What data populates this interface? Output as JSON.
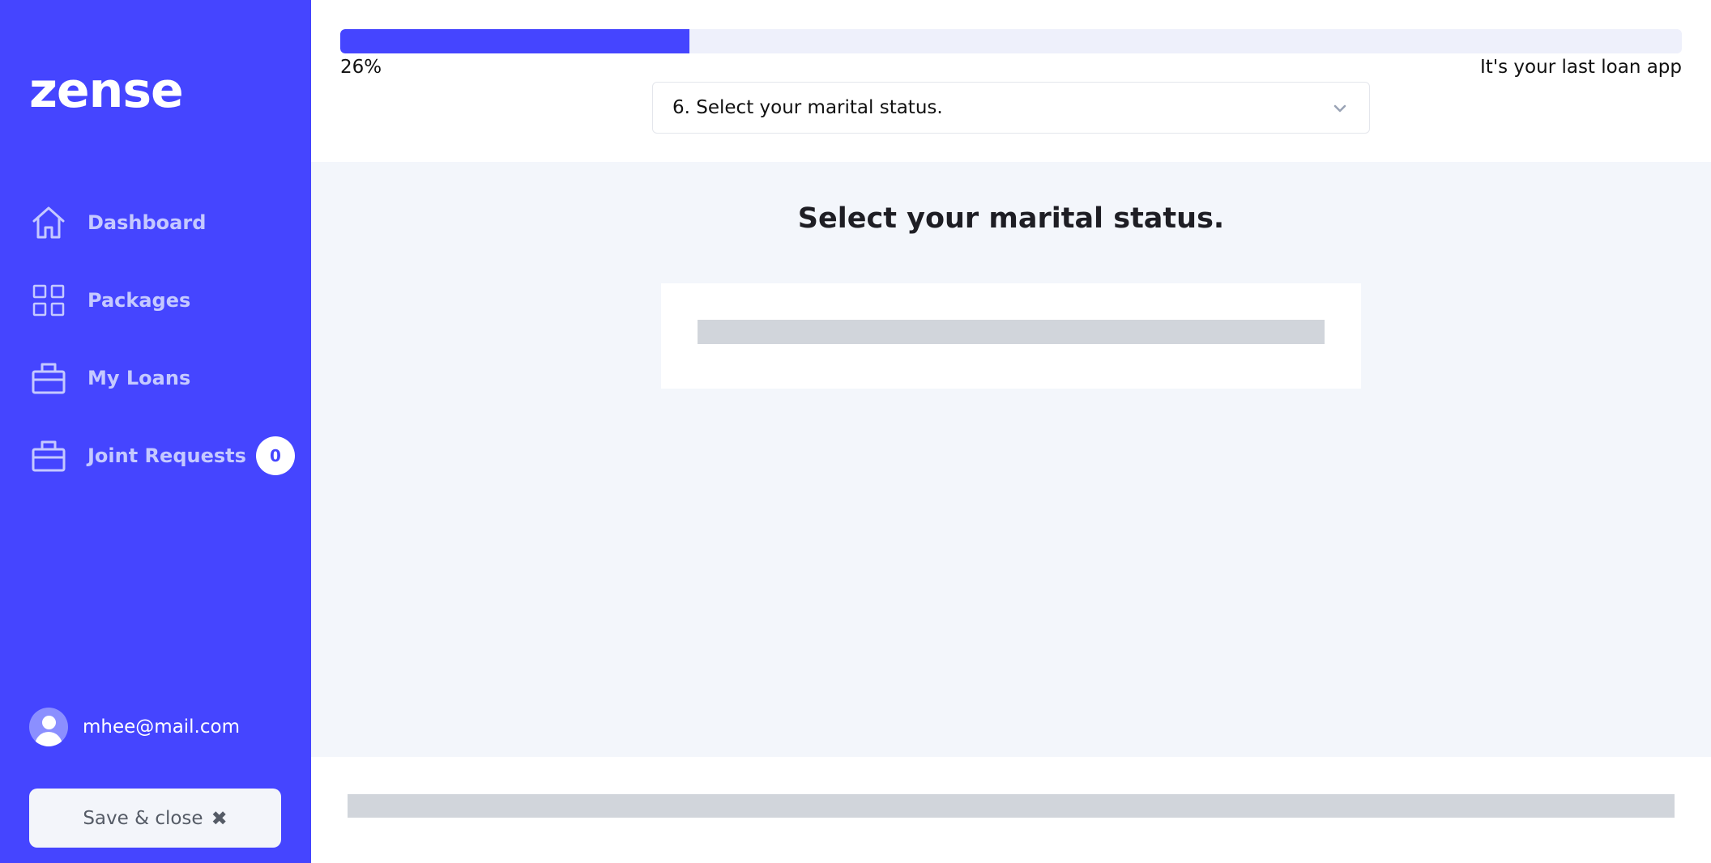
{
  "brand": {
    "logo_text": "zense",
    "accent": "#4545ff"
  },
  "sidebar": {
    "items": [
      {
        "label": "Dashboard",
        "icon": "home-icon"
      },
      {
        "label": "Packages",
        "icon": "grid-icon"
      },
      {
        "label": "My Loans",
        "icon": "briefcase-icon"
      },
      {
        "label": "Joint Requests",
        "icon": "briefcase-icon",
        "badge": "0"
      }
    ],
    "user_email": "mhee@mail.com",
    "save_close_label": "Save & close"
  },
  "progress": {
    "value_percent": 26,
    "label": "26%",
    "tagline": "It's your last loan app"
  },
  "step_selector": {
    "value": "6. Select your marital status."
  },
  "question": {
    "title": "Select your marital status."
  }
}
